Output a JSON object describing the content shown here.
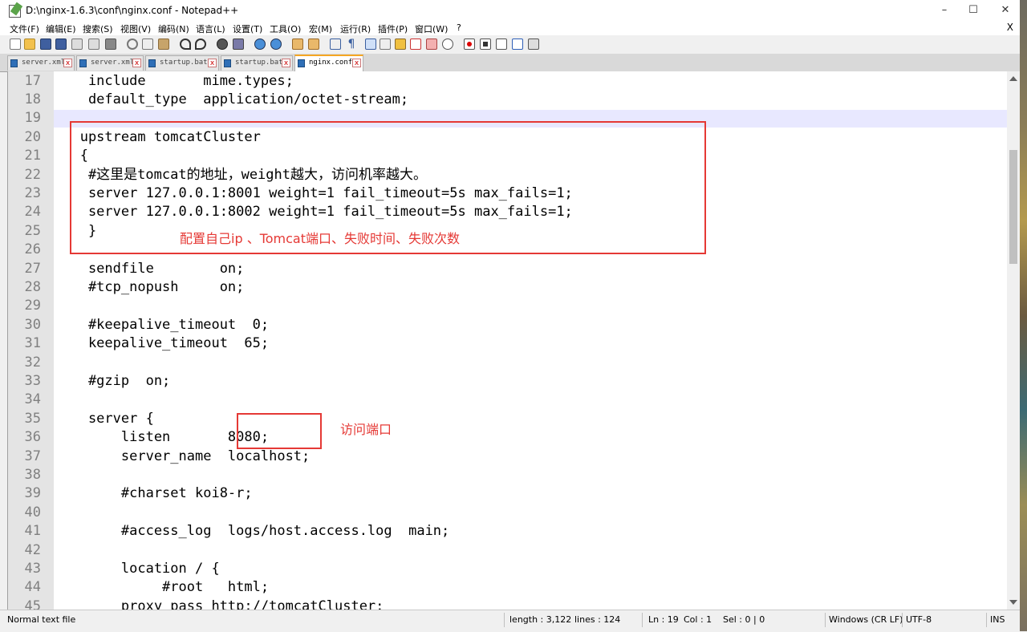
{
  "window": {
    "title": "D:\\nginx-1.6.3\\conf\\nginx.conf - Notepad++",
    "minimize_glyph": "–",
    "maximize_glyph": "☐",
    "close_glyph": "✕"
  },
  "menu": {
    "items": [
      "文件(F)",
      "编辑(E)",
      "搜索(S)",
      "视图(V)",
      "编码(N)",
      "语言(L)",
      "设置(T)",
      "工具(O)",
      "宏(M)",
      "运行(R)",
      "插件(P)",
      "窗口(W)",
      "?"
    ],
    "close_glyph": "X"
  },
  "toolbar": {
    "buttons": [
      "new-file",
      "open-file",
      "save",
      "save-all",
      "close",
      "close-all",
      "print",
      "cut",
      "copy",
      "paste",
      "undo",
      "redo",
      "find",
      "replace",
      "zoom-in",
      "zoom-out",
      "sync-vertical",
      "sync-horizontal",
      "word-wrap",
      "show-all-chars",
      "indent-guide",
      "doc-map",
      "function-list",
      "folder-workspace",
      "monitoring",
      "record-macro",
      "stop-record",
      "play-macro",
      "run-macro-multiple",
      "save-macro"
    ]
  },
  "tabs": [
    {
      "label": "server.xml",
      "active": false
    },
    {
      "label": "server.xml",
      "active": false
    },
    {
      "label": "startup.bat",
      "active": false
    },
    {
      "label": "startup.bat",
      "active": false
    },
    {
      "label": "nginx.conf",
      "active": true
    }
  ],
  "editor": {
    "lines": [
      {
        "n": "17",
        "text": "    include       mime.types;"
      },
      {
        "n": "18",
        "text": "    default_type  application/octet-stream;"
      },
      {
        "n": "19",
        "text": ""
      },
      {
        "n": "20",
        "text": "   upstream tomcatCluster"
      },
      {
        "n": "21",
        "text": "   {"
      },
      {
        "n": "22",
        "text": "    #这里是tomcat的地址，weight越大，访问机率越大。"
      },
      {
        "n": "23",
        "text": "    server 127.0.0.1:8001 weight=1 fail_timeout=5s max_fails=1;"
      },
      {
        "n": "24",
        "text": "    server 127.0.0.1:8002 weight=1 fail_timeout=5s max_fails=1;"
      },
      {
        "n": "25",
        "text": "    }"
      },
      {
        "n": "26",
        "text": ""
      },
      {
        "n": "27",
        "text": "    sendfile        on;"
      },
      {
        "n": "28",
        "text": "    #tcp_nopush     on;"
      },
      {
        "n": "29",
        "text": ""
      },
      {
        "n": "30",
        "text": "    #keepalive_timeout  0;"
      },
      {
        "n": "31",
        "text": "    keepalive_timeout  65;"
      },
      {
        "n": "32",
        "text": ""
      },
      {
        "n": "33",
        "text": "    #gzip  on;"
      },
      {
        "n": "34",
        "text": ""
      },
      {
        "n": "35",
        "text": "    server {"
      },
      {
        "n": "36",
        "text": "        listen       8080;"
      },
      {
        "n": "37",
        "text": "        server_name  localhost;"
      },
      {
        "n": "38",
        "text": ""
      },
      {
        "n": "39",
        "text": "        #charset koi8-r;"
      },
      {
        "n": "40",
        "text": ""
      },
      {
        "n": "41",
        "text": "        #access_log  logs/host.access.log  main;"
      },
      {
        "n": "42",
        "text": ""
      },
      {
        "n": "43",
        "text": "        location / {"
      },
      {
        "n": "44",
        "text": "             #root   html;"
      },
      {
        "n": "45",
        "text": "        proxy_pass http://tomcatCluster;"
      }
    ]
  },
  "annotations": {
    "upstream_note": "配置自己ip 、Tomcat端口、失败时间、失败次数",
    "port_note": "访问端口",
    "color": "#e53935"
  },
  "statusbar": {
    "file_type": "Normal text file",
    "length": "length : 3,122",
    "lines": "lines : 124",
    "ln": "Ln : 19",
    "col": "Col : 1",
    "sel": "Sel : 0 | 0",
    "eol": "Windows (CR LF)",
    "encoding": "UTF-8",
    "ins": "INS"
  }
}
